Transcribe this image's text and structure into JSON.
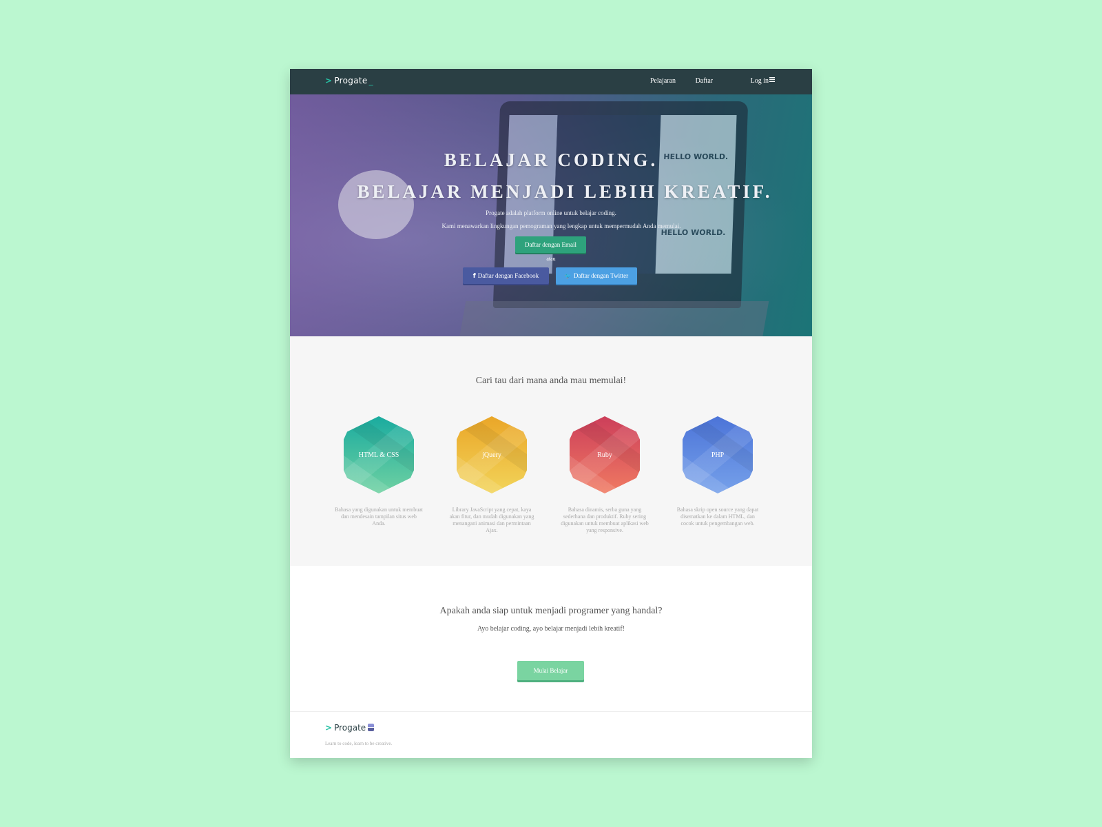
{
  "nav": {
    "logo_text": "Progate",
    "logo_prefix": ">",
    "logo_suffix": "_",
    "links": [
      "Pelajaran",
      "Daftar",
      "Log in"
    ]
  },
  "hero": {
    "title_line1": "BELAJAR CODING.",
    "title_line2": "BELAJAR MENJADI LEBIH KREATIF.",
    "sub_line1": "Progate adalah platform online untuk belajar coding.",
    "sub_line2": "Kami menawarkan lingkungan pemograman yang lengkap untuk mempermudah Anda memulai.",
    "email_button": "Daftar dengan Email",
    "or_text": "atau",
    "facebook_button": "Daftar dengan Facebook",
    "twitter_button": "Daftar dengan Twitter",
    "screen_text": "HELLO WORLD."
  },
  "courses": {
    "heading": "Cari tau dari mana anda mau memulai!",
    "items": [
      {
        "name": "HTML & CSS",
        "description": "Bahasa yang digunakan untuk membuat dan mendesain tampilan situs web Anda.",
        "color_top": "#1aab9f",
        "color_bottom": "#6fd1a2"
      },
      {
        "name": "jQuery",
        "description": "Library JavaScript yang cepat, kaya akan fitur, dan mudah digunakan yang menangani animasi dan permintaan Ajax.",
        "color_top": "#eaa628",
        "color_bottom": "#f2d45a"
      },
      {
        "name": "Ruby",
        "description": "Bahasa dinamis, serba guna yang sederhana dan produktif. Ruby sering digunakan untuk membuat aplikasi web yang responsive.",
        "color_top": "#cc3e5a",
        "color_bottom": "#f07a62"
      },
      {
        "name": "PHP",
        "description": "Bahasa skrip open source yang dapat disematkan ke dalam HTML, dan cocok untuk pengembangan web.",
        "color_top": "#4c74d8",
        "color_bottom": "#76a1ea"
      }
    ]
  },
  "cta": {
    "title": "Apakah anda siap untuk menjadi programer yang handal?",
    "subtitle": "Ayo belajar coding, ayo belajar menjadi lebih kreatif!",
    "button": "Mulai Belajar"
  },
  "footer": {
    "logo_text": "Progate",
    "tagline": "Learn to code, learn to be creative."
  },
  "colors": {
    "page_bg": "#bbf7d0",
    "nav_bg": "#2a3f44",
    "accent": "#27c1a4",
    "email_button": "#2ea27c",
    "facebook": "#4a5aa0",
    "twitter": "#4ca0e3",
    "start_button": "#7ad4a1"
  }
}
